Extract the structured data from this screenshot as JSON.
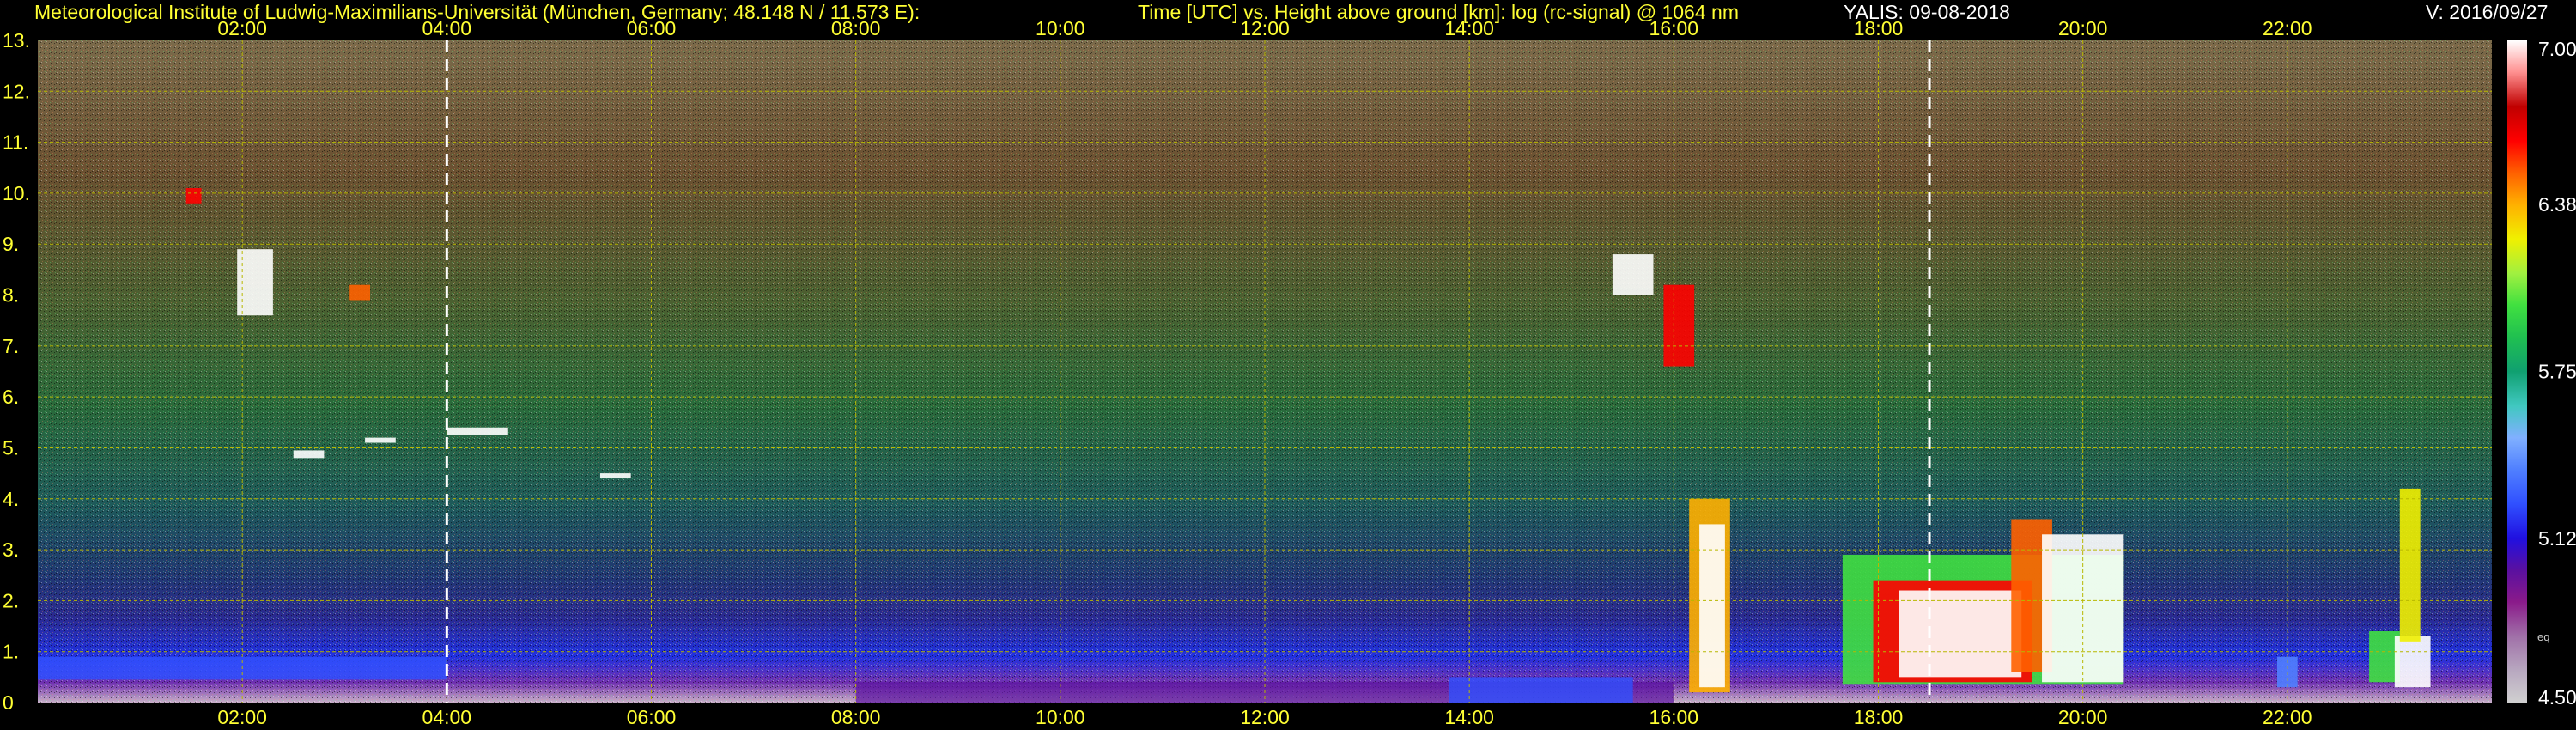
{
  "header": {
    "institute": "Meteorological Institute of Ludwig-Maximilians-Universität (München, Germany; 48.148 N / 11.573 E):",
    "plot_title": "Time [UTC] vs. Height above ground [km]: log (rc-signal) @ 1064 nm",
    "station_date": "YALIS: 09-08-2018",
    "version": "V: 2016/09/27"
  },
  "colors": {
    "label_yellow": "#ffff33",
    "grid_yellow": "#b8b800",
    "marker_white": "#ffffff",
    "background": "#000000"
  },
  "chart_data": {
    "type": "heatmap",
    "title": "Time [UTC] vs. Height above ground [km]: log (rc-signal) @ 1064 nm",
    "xlabel": "Time [UTC]",
    "ylabel": "Height above ground [km]",
    "xlim": [
      0,
      24
    ],
    "ylim": [
      0,
      13
    ],
    "x_ticks": [
      "02:00",
      "04:00",
      "06:00",
      "08:00",
      "10:00",
      "12:00",
      "14:00",
      "16:00",
      "18:00",
      "20:00",
      "22:00"
    ],
    "x_tick_values": [
      2,
      4,
      6,
      8,
      10,
      12,
      14,
      16,
      18,
      20,
      22
    ],
    "y_ticks": [
      "0",
      "1.",
      "2.",
      "3.",
      "4.",
      "5.",
      "6.",
      "7.",
      "8.",
      "9.",
      "10.",
      "11.",
      "12.",
      "13."
    ],
    "y_tick_values": [
      0,
      1,
      2,
      3,
      4,
      5,
      6,
      7,
      8,
      9,
      10,
      11,
      12,
      13
    ],
    "grid": true,
    "colorbar": {
      "min": 4.5,
      "max": 7.0,
      "tick_labels": [
        "7.00",
        "6.38",
        "5.75",
        "5.12",
        "4.50"
      ],
      "tick_values": [
        7.0,
        6.38,
        5.75,
        5.12,
        4.5
      ],
      "extra_label": "eq",
      "extra_label_value": 4.75,
      "stops": [
        [
          4.5,
          "#d0d0d0"
        ],
        [
          4.62,
          "#b8a8c0"
        ],
        [
          4.75,
          "#a070a8"
        ],
        [
          4.88,
          "#8a1a8a"
        ],
        [
          5.0,
          "#5a10a0"
        ],
        [
          5.12,
          "#2010e0"
        ],
        [
          5.25,
          "#3050ff"
        ],
        [
          5.38,
          "#5080ff"
        ],
        [
          5.5,
          "#80b0ff"
        ],
        [
          5.62,
          "#40c8c0"
        ],
        [
          5.75,
          "#10a070"
        ],
        [
          5.88,
          "#20c050"
        ],
        [
          6.0,
          "#40e040"
        ],
        [
          6.12,
          "#a0f040"
        ],
        [
          6.25,
          "#f0f000"
        ],
        [
          6.38,
          "#ffb000"
        ],
        [
          6.5,
          "#ff6000"
        ],
        [
          6.62,
          "#ff0000"
        ],
        [
          6.75,
          "#c00000"
        ],
        [
          6.88,
          "#ff9090"
        ],
        [
          7.0,
          "#ffffff"
        ]
      ]
    },
    "marker_lines_x": [
      4.0,
      18.5
    ]
  }
}
